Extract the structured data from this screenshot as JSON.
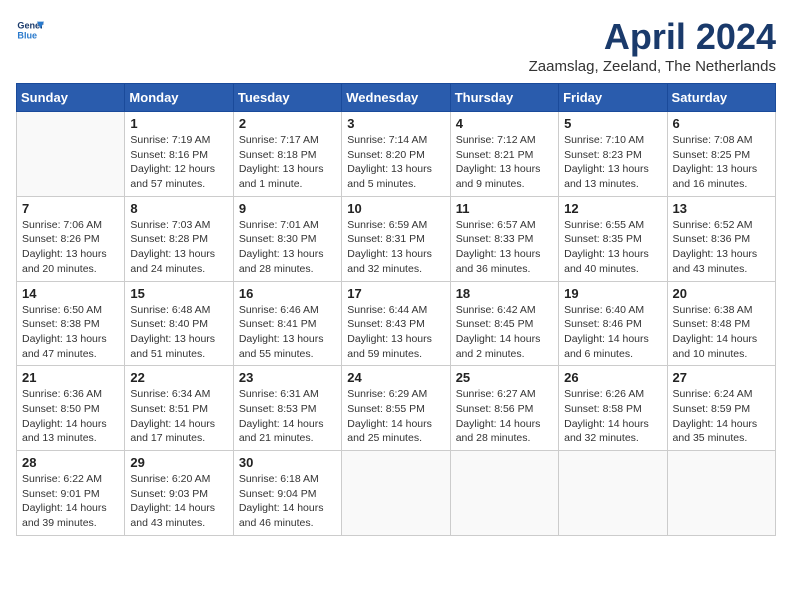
{
  "header": {
    "logo_line1": "General",
    "logo_line2": "Blue",
    "month_year": "April 2024",
    "location": "Zaamslag, Zeeland, The Netherlands"
  },
  "weekdays": [
    "Sunday",
    "Monday",
    "Tuesday",
    "Wednesday",
    "Thursday",
    "Friday",
    "Saturday"
  ],
  "weeks": [
    [
      {
        "day": "",
        "sunrise": "",
        "sunset": "",
        "daylight": ""
      },
      {
        "day": "1",
        "sunrise": "Sunrise: 7:19 AM",
        "sunset": "Sunset: 8:16 PM",
        "daylight": "Daylight: 12 hours and 57 minutes."
      },
      {
        "day": "2",
        "sunrise": "Sunrise: 7:17 AM",
        "sunset": "Sunset: 8:18 PM",
        "daylight": "Daylight: 13 hours and 1 minute."
      },
      {
        "day": "3",
        "sunrise": "Sunrise: 7:14 AM",
        "sunset": "Sunset: 8:20 PM",
        "daylight": "Daylight: 13 hours and 5 minutes."
      },
      {
        "day": "4",
        "sunrise": "Sunrise: 7:12 AM",
        "sunset": "Sunset: 8:21 PM",
        "daylight": "Daylight: 13 hours and 9 minutes."
      },
      {
        "day": "5",
        "sunrise": "Sunrise: 7:10 AM",
        "sunset": "Sunset: 8:23 PM",
        "daylight": "Daylight: 13 hours and 13 minutes."
      },
      {
        "day": "6",
        "sunrise": "Sunrise: 7:08 AM",
        "sunset": "Sunset: 8:25 PM",
        "daylight": "Daylight: 13 hours and 16 minutes."
      }
    ],
    [
      {
        "day": "7",
        "sunrise": "Sunrise: 7:06 AM",
        "sunset": "Sunset: 8:26 PM",
        "daylight": "Daylight: 13 hours and 20 minutes."
      },
      {
        "day": "8",
        "sunrise": "Sunrise: 7:03 AM",
        "sunset": "Sunset: 8:28 PM",
        "daylight": "Daylight: 13 hours and 24 minutes."
      },
      {
        "day": "9",
        "sunrise": "Sunrise: 7:01 AM",
        "sunset": "Sunset: 8:30 PM",
        "daylight": "Daylight: 13 hours and 28 minutes."
      },
      {
        "day": "10",
        "sunrise": "Sunrise: 6:59 AM",
        "sunset": "Sunset: 8:31 PM",
        "daylight": "Daylight: 13 hours and 32 minutes."
      },
      {
        "day": "11",
        "sunrise": "Sunrise: 6:57 AM",
        "sunset": "Sunset: 8:33 PM",
        "daylight": "Daylight: 13 hours and 36 minutes."
      },
      {
        "day": "12",
        "sunrise": "Sunrise: 6:55 AM",
        "sunset": "Sunset: 8:35 PM",
        "daylight": "Daylight: 13 hours and 40 minutes."
      },
      {
        "day": "13",
        "sunrise": "Sunrise: 6:52 AM",
        "sunset": "Sunset: 8:36 PM",
        "daylight": "Daylight: 13 hours and 43 minutes."
      }
    ],
    [
      {
        "day": "14",
        "sunrise": "Sunrise: 6:50 AM",
        "sunset": "Sunset: 8:38 PM",
        "daylight": "Daylight: 13 hours and 47 minutes."
      },
      {
        "day": "15",
        "sunrise": "Sunrise: 6:48 AM",
        "sunset": "Sunset: 8:40 PM",
        "daylight": "Daylight: 13 hours and 51 minutes."
      },
      {
        "day": "16",
        "sunrise": "Sunrise: 6:46 AM",
        "sunset": "Sunset: 8:41 PM",
        "daylight": "Daylight: 13 hours and 55 minutes."
      },
      {
        "day": "17",
        "sunrise": "Sunrise: 6:44 AM",
        "sunset": "Sunset: 8:43 PM",
        "daylight": "Daylight: 13 hours and 59 minutes."
      },
      {
        "day": "18",
        "sunrise": "Sunrise: 6:42 AM",
        "sunset": "Sunset: 8:45 PM",
        "daylight": "Daylight: 14 hours and 2 minutes."
      },
      {
        "day": "19",
        "sunrise": "Sunrise: 6:40 AM",
        "sunset": "Sunset: 8:46 PM",
        "daylight": "Daylight: 14 hours and 6 minutes."
      },
      {
        "day": "20",
        "sunrise": "Sunrise: 6:38 AM",
        "sunset": "Sunset: 8:48 PM",
        "daylight": "Daylight: 14 hours and 10 minutes."
      }
    ],
    [
      {
        "day": "21",
        "sunrise": "Sunrise: 6:36 AM",
        "sunset": "Sunset: 8:50 PM",
        "daylight": "Daylight: 14 hours and 13 minutes."
      },
      {
        "day": "22",
        "sunrise": "Sunrise: 6:34 AM",
        "sunset": "Sunset: 8:51 PM",
        "daylight": "Daylight: 14 hours and 17 minutes."
      },
      {
        "day": "23",
        "sunrise": "Sunrise: 6:31 AM",
        "sunset": "Sunset: 8:53 PM",
        "daylight": "Daylight: 14 hours and 21 minutes."
      },
      {
        "day": "24",
        "sunrise": "Sunrise: 6:29 AM",
        "sunset": "Sunset: 8:55 PM",
        "daylight": "Daylight: 14 hours and 25 minutes."
      },
      {
        "day": "25",
        "sunrise": "Sunrise: 6:27 AM",
        "sunset": "Sunset: 8:56 PM",
        "daylight": "Daylight: 14 hours and 28 minutes."
      },
      {
        "day": "26",
        "sunrise": "Sunrise: 6:26 AM",
        "sunset": "Sunset: 8:58 PM",
        "daylight": "Daylight: 14 hours and 32 minutes."
      },
      {
        "day": "27",
        "sunrise": "Sunrise: 6:24 AM",
        "sunset": "Sunset: 8:59 PM",
        "daylight": "Daylight: 14 hours and 35 minutes."
      }
    ],
    [
      {
        "day": "28",
        "sunrise": "Sunrise: 6:22 AM",
        "sunset": "Sunset: 9:01 PM",
        "daylight": "Daylight: 14 hours and 39 minutes."
      },
      {
        "day": "29",
        "sunrise": "Sunrise: 6:20 AM",
        "sunset": "Sunset: 9:03 PM",
        "daylight": "Daylight: 14 hours and 43 minutes."
      },
      {
        "day": "30",
        "sunrise": "Sunrise: 6:18 AM",
        "sunset": "Sunset: 9:04 PM",
        "daylight": "Daylight: 14 hours and 46 minutes."
      },
      {
        "day": "",
        "sunrise": "",
        "sunset": "",
        "daylight": ""
      },
      {
        "day": "",
        "sunrise": "",
        "sunset": "",
        "daylight": ""
      },
      {
        "day": "",
        "sunrise": "",
        "sunset": "",
        "daylight": ""
      },
      {
        "day": "",
        "sunrise": "",
        "sunset": "",
        "daylight": ""
      }
    ]
  ]
}
